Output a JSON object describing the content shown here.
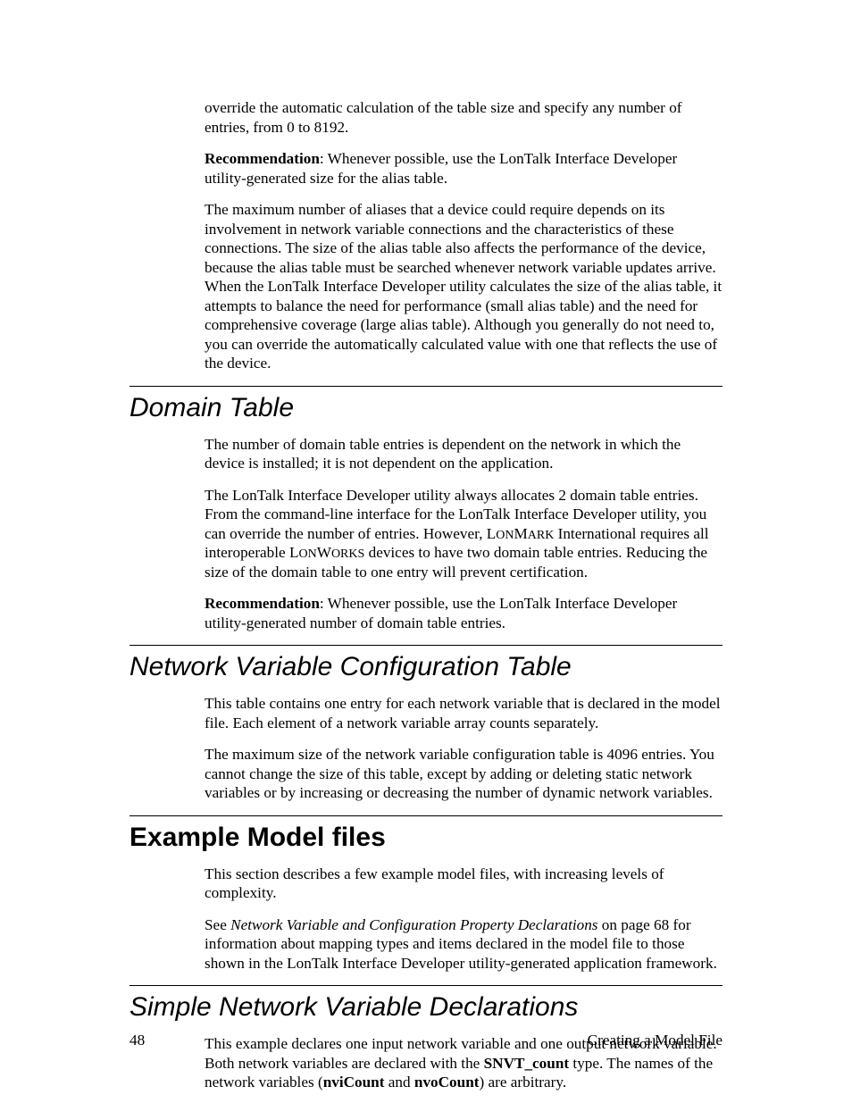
{
  "para1": "override the automatic calculation of the table size and specify any number of entries, from 0 to 8192.",
  "rec1_label": "Recommendation",
  "rec1_rest": ":  Whenever possible, use the LonTalk Interface Developer utility-generated size for the alias table.",
  "para2": "The maximum number of aliases that a device could require depends on its involvement in network variable connections and the characteristics of these connections.  The size of the alias table also affects the performance of the device, because the alias table must be searched whenever network variable updates arrive.  When the LonTalk Interface Developer utility calculates the size of the alias table, it attempts to balance the need for performance (small alias table) and the need for comprehensive coverage (large alias table).  Although you generally do not need to, you can override the automatically calculated value with one that reflects the use of the device.",
  "h_domain": "Domain Table",
  "domain_p1": "The number of domain table entries is dependent on the network in which the device is installed; it is not dependent on the application.",
  "domain_p2_a": "The LonTalk Interface Developer utility always allocates 2 domain table entries.  From the command-line interface for the LonTalk Interface Developer utility, you can override the number of entries.  However, L",
  "domain_p2_b": "ON",
  "domain_p2_c": "M",
  "domain_p2_d": "ARK",
  "domain_p2_e": " International requires all interoperable L",
  "domain_p2_f": "ON",
  "domain_p2_g": "W",
  "domain_p2_h": "ORKS",
  "domain_p2_i": " devices to have two domain table entries.  Reducing the size of the domain table to one entry will prevent certification.",
  "rec2_label": "Recommendation",
  "rec2_rest": ":  Whenever possible, use the LonTalk Interface Developer utility-generated number of domain table entries.",
  "h_nvct": "Network Variable Configuration Table",
  "nvct_p1": "This table contains one entry for each network variable that is declared in the model file.  Each element of a network variable array counts separately.",
  "nvct_p2": "The maximum size of the network variable configuration table is 4096 entries.  You cannot change the size of this table, except by adding or deleting static network variables or by increasing or decreasing the number of dynamic network variables.",
  "h_example": "Example Model files",
  "ex_p1": "This section describes a few example model files, with increasing levels of complexity.",
  "ex_p2_a": "See ",
  "ex_p2_b": "Network Variable and Configuration Property Declarations",
  "ex_p2_c": " on page 68 for information about mapping types and items declared in the model file to those shown in the LonTalk Interface Developer utility-generated application framework.",
  "h_simple": "Simple Network Variable Declarations",
  "simple_p1_a": "This example declares one input network variable and one output network variable.  Both network variables are declared with the ",
  "simple_p1_b": "SNVT_count",
  "simple_p1_c": " type.  The names of the network variables (",
  "simple_p1_d": "nviCount",
  "simple_p1_e": " and ",
  "simple_p1_f": "nvoCount",
  "simple_p1_g": ") are arbitrary.",
  "footer_page": "48",
  "footer_title": "Creating a Model File"
}
